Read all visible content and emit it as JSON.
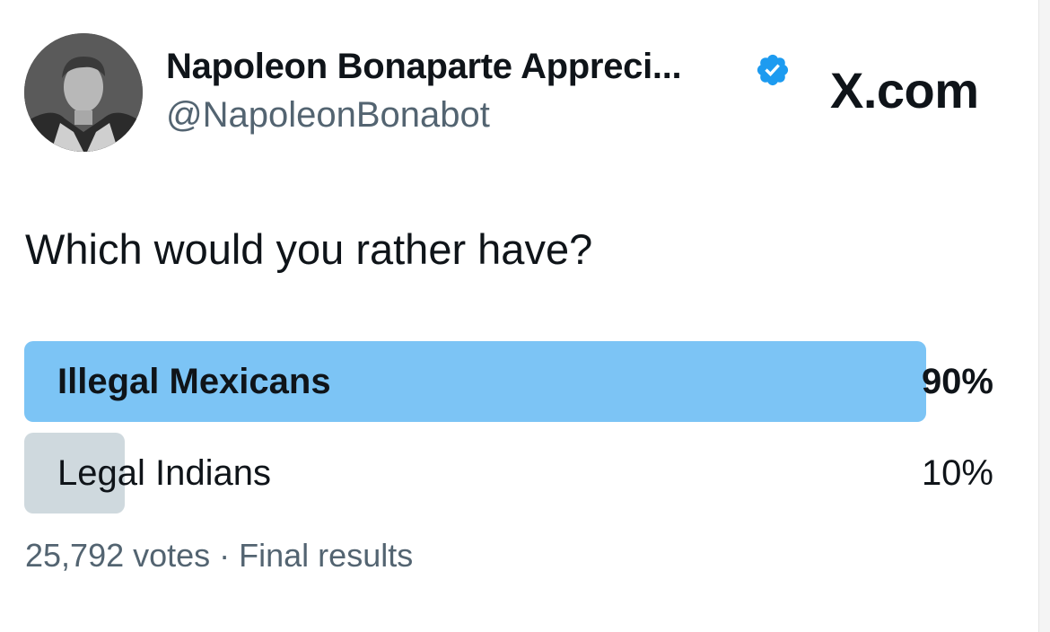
{
  "tweet": {
    "display_name": "Napoleon Bonaparte Appreci...",
    "handle": "@NapoleonBonabot",
    "verified": true,
    "watermark": "X.com"
  },
  "poll": {
    "question": "Which would you rather have?",
    "options": [
      {
        "label": "Illegal Mexicans",
        "percent_text": "90%",
        "percent": 90,
        "winner": true,
        "bar_color": "#7cc4f5"
      },
      {
        "label": "Legal Indians",
        "percent_text": "10%",
        "percent": 10,
        "winner": false,
        "bar_color": "#cfd9de"
      }
    ],
    "meta": "25,792 votes · Final results"
  },
  "colors": {
    "text": "#0f1419",
    "secondary": "#536471",
    "verified": "#1d9bf0"
  }
}
